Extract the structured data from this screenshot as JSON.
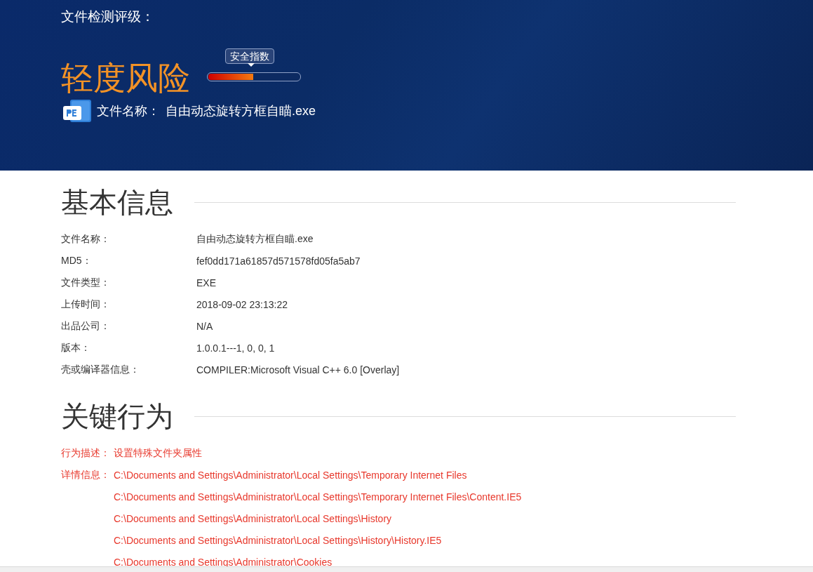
{
  "header": {
    "rating_label": "文件检测评级：",
    "risk_level": "轻度风险",
    "meter": {
      "tooltip": "安全指数",
      "level": 0.49
    },
    "file_label": "文件名称：",
    "file_name": "自由动态旋转方框自瞄.exe"
  },
  "sections": [
    {
      "title": "基本信息",
      "kind": "info",
      "rows": [
        {
          "label": "文件名称：",
          "value": "自由动态旋转方框自瞄.exe"
        },
        {
          "label": "MD5：",
          "value": "fef0dd171a61857d571578fd05fa5ab7"
        },
        {
          "label": "文件类型：",
          "value": "EXE"
        },
        {
          "label": "上传时间：",
          "value": "2018-09-02 23:13:22"
        },
        {
          "label": "出品公司：",
          "value": "N/A"
        },
        {
          "label": "版本：",
          "value": "1.0.0.1---1, 0, 0, 1"
        },
        {
          "label": "壳或编译器信息：",
          "value": "COMPILER:Microsoft Visual C++ 6.0 [Overlay]"
        }
      ]
    },
    {
      "title": "关键行为",
      "kind": "behavior",
      "description_label": "行为描述：",
      "description": "设置特殊文件夹属性",
      "details_label": "详情信息：",
      "details": [
        "C:\\Documents and Settings\\Administrator\\Local Settings\\Temporary Internet Files",
        "C:\\Documents and Settings\\Administrator\\Local Settings\\Temporary Internet Files\\Content.IE5",
        "C:\\Documents and Settings\\Administrator\\Local Settings\\History",
        "C:\\Documents and Settings\\Administrator\\Local Settings\\History\\History.IE5",
        "C:\\Documents and Settings\\Administrator\\Cookies"
      ]
    }
  ]
}
